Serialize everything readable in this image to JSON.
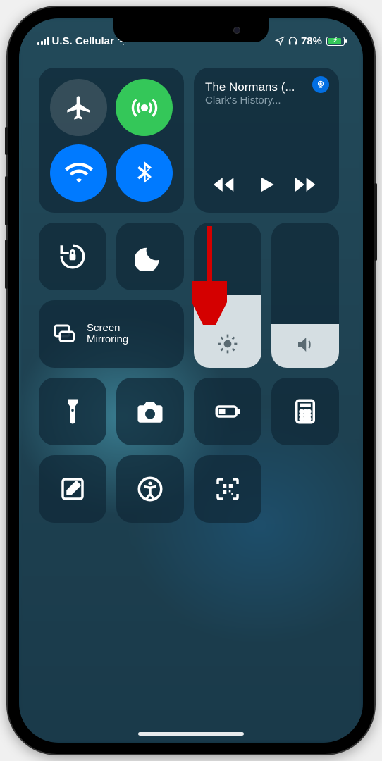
{
  "status": {
    "carrier": "U.S. Cellular",
    "battery_pct": "78%",
    "battery_fill_pct": 78
  },
  "media": {
    "title": "The Normans (...",
    "subtitle": "Clark's History..."
  },
  "connectivity": {
    "airplane_on": false,
    "cellular_on": true,
    "wifi_on": true,
    "bluetooth_on": true
  },
  "sliders": {
    "brightness_pct": 50,
    "volume_pct": 30
  },
  "screen_mirroring_label": "Screen\nMirroring"
}
